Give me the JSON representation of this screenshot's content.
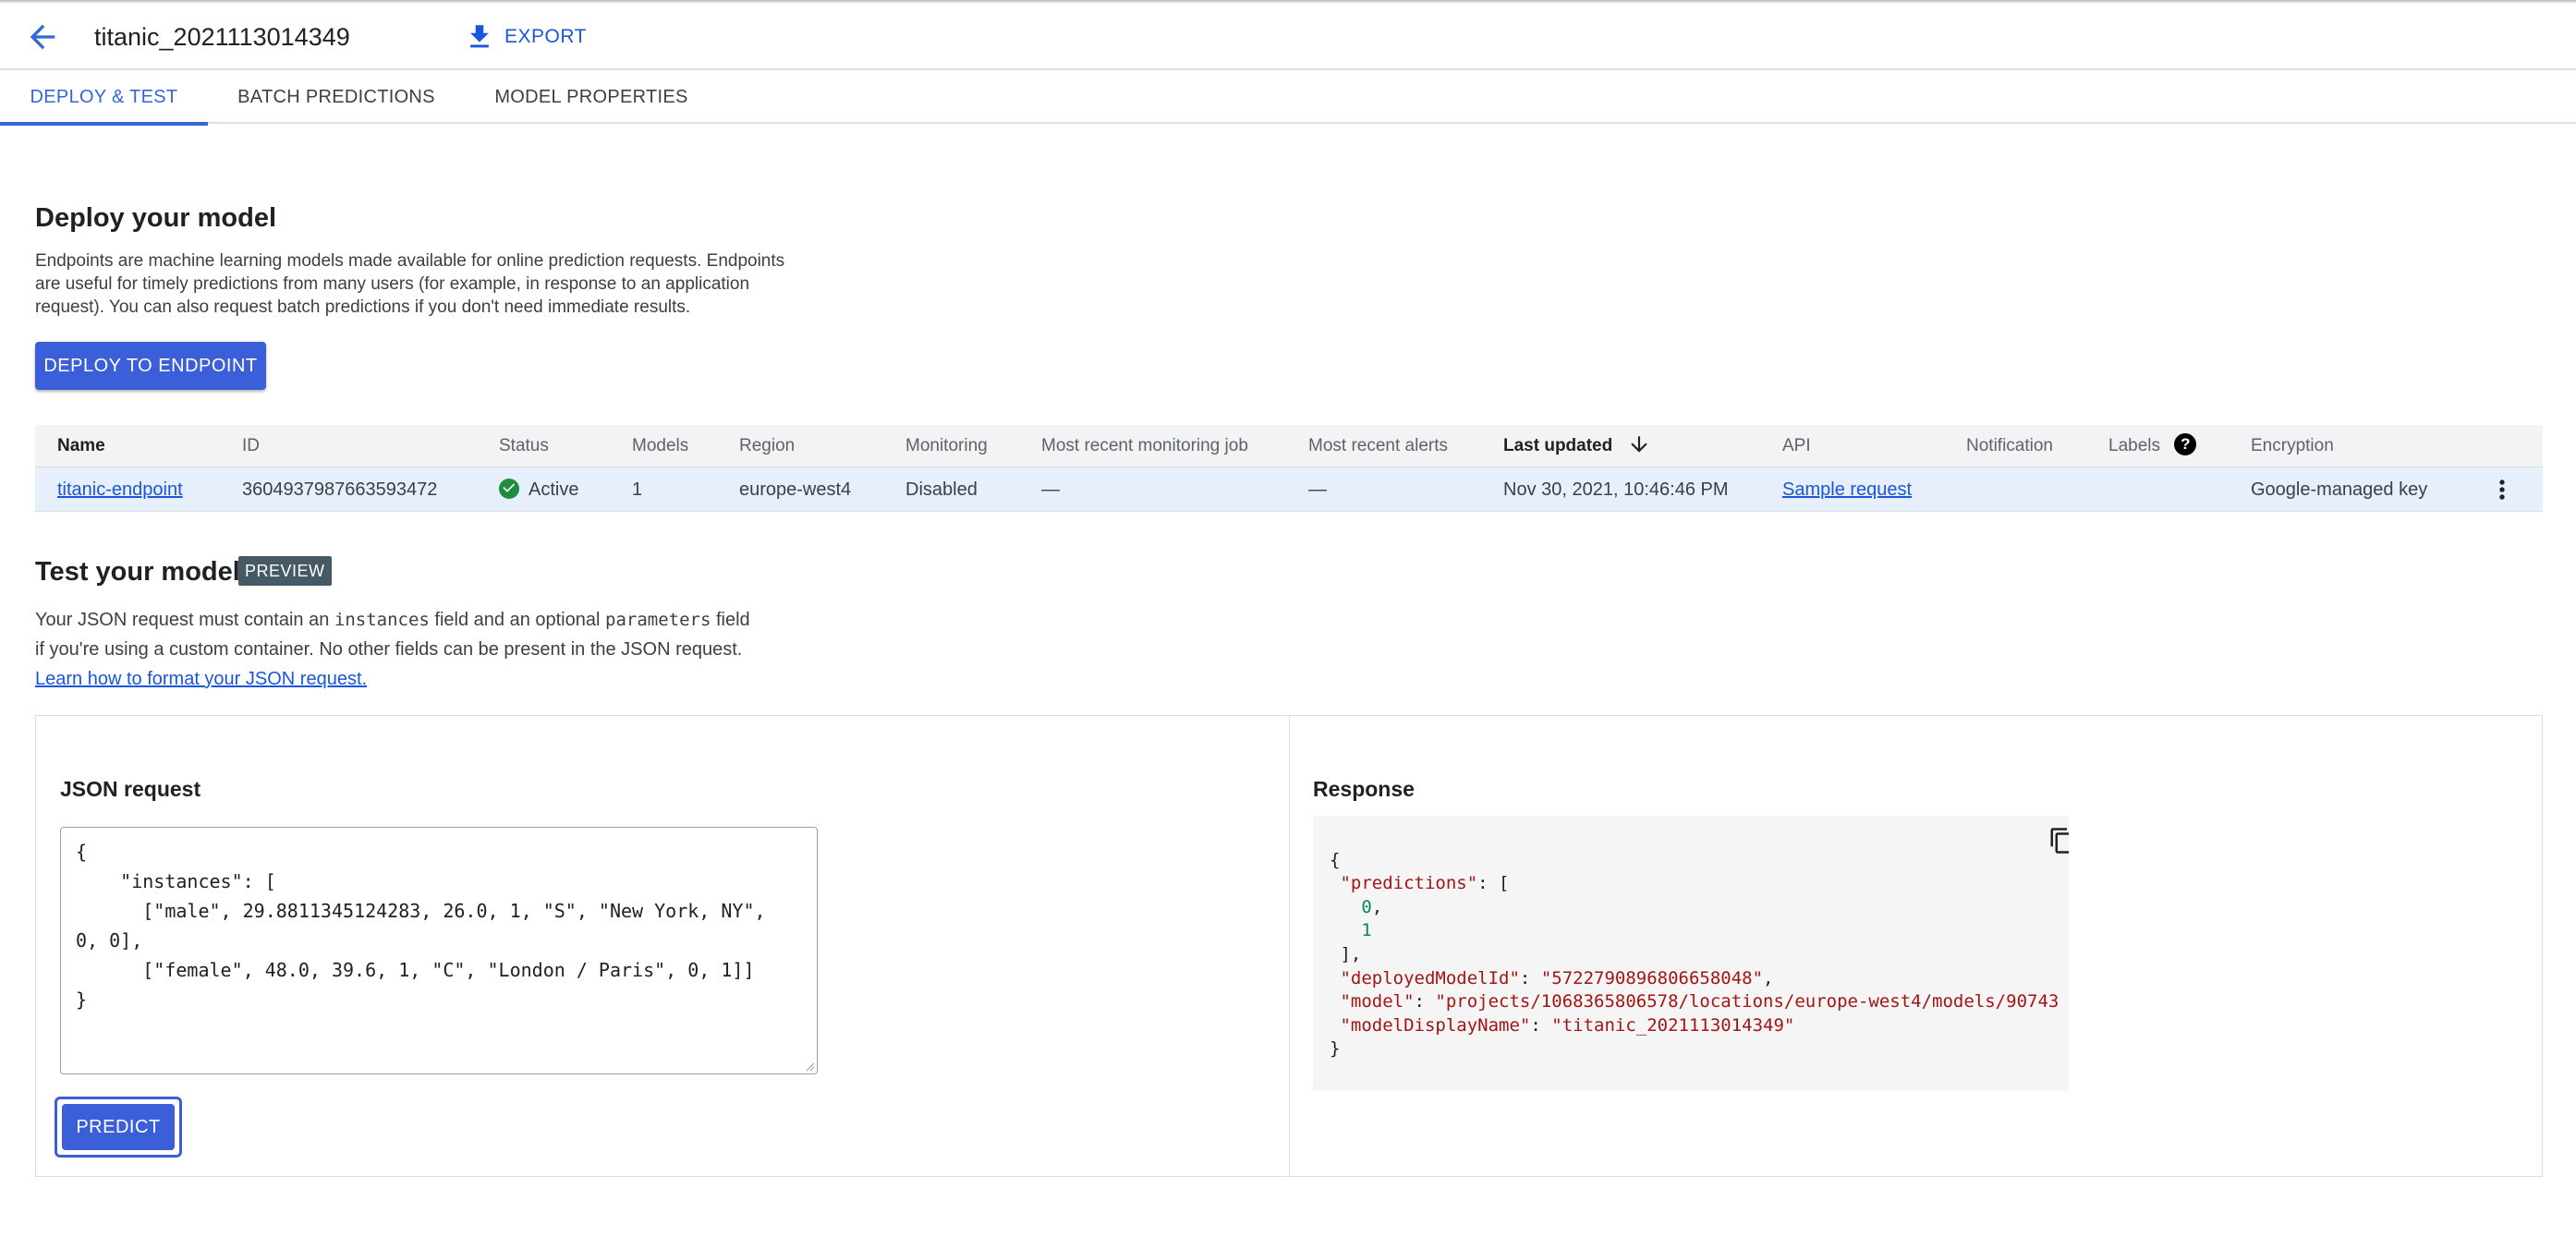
{
  "header": {
    "title": "titanic_2021113014349",
    "export_label": "EXPORT"
  },
  "tabs": [
    {
      "label": "DEPLOY & TEST",
      "active": true
    },
    {
      "label": "BATCH PREDICTIONS",
      "active": false
    },
    {
      "label": "MODEL PROPERTIES",
      "active": false
    }
  ],
  "deploy": {
    "title": "Deploy your model",
    "description_lines": [
      "Endpoints are machine learning models made available for online prediction requests. Endpoints",
      "are useful for timely predictions from many users (for example, in response to an application",
      "request). You can also request batch predictions if you don't need immediate results."
    ],
    "button_label": "DEPLOY TO ENDPOINT"
  },
  "endpoints_table": {
    "columns": [
      "Name",
      "ID",
      "Status",
      "Models",
      "Region",
      "Monitoring",
      "Most recent monitoring job",
      "Most recent alerts",
      "Last updated",
      "API",
      "Notification",
      "Labels",
      "Encryption"
    ],
    "rows": [
      {
        "name": "titanic-endpoint",
        "id": "3604937987663593472",
        "status": "Active",
        "models": "1",
        "region": "europe-west4",
        "monitoring": "Disabled",
        "recent_job": "—",
        "recent_alerts": "—",
        "last_updated": "Nov 30, 2021, 10:46:46 PM",
        "api": "Sample request",
        "notification": "",
        "labels": "",
        "encryption": "Google-managed key"
      }
    ]
  },
  "test": {
    "title": "Test your model",
    "badge": "PREVIEW",
    "desc_part1": "Your JSON request must contain an ",
    "code1": "instances",
    "desc_part2": " field and an optional ",
    "code2": "parameters",
    "desc_part3": " field",
    "desc_line2": "if you're using a custom container. No other fields can be present in the JSON request.",
    "learn_link": "Learn how to format your JSON request."
  },
  "json_request": {
    "label": "JSON request",
    "value": "{\n    \"instances\": [\n      [\"male\", 29.8811345124283, 26.0, 1, \"S\", \"New York, NY\",\n0, 0],\n      [\"female\", 48.0, 39.6, 1, \"C\", \"London / Paris\", 0, 1]]\n}",
    "predict_label": "PREDICT"
  },
  "response": {
    "label": "Response",
    "open_brace": "{",
    "predictions_key": "\"predictions\"",
    "pred_open": ": [",
    "pred_values": [
      "0",
      "1"
    ],
    "pred_close": "],",
    "deployed_key": "\"deployedModelId\"",
    "deployed_value": "\"5722790896806658048\"",
    "model_key": "\"model\"",
    "model_value": "\"projects/1068365806578/locations/europe-west4/models/90743",
    "display_key": "\"modelDisplayName\"",
    "display_value": "\"titanic_2021113014349\"",
    "close_brace": "}"
  },
  "colors": {
    "accent": "#3b5fd9",
    "link": "#1a56db",
    "active_status": "#1e8e3e",
    "badge": "#455a64"
  }
}
